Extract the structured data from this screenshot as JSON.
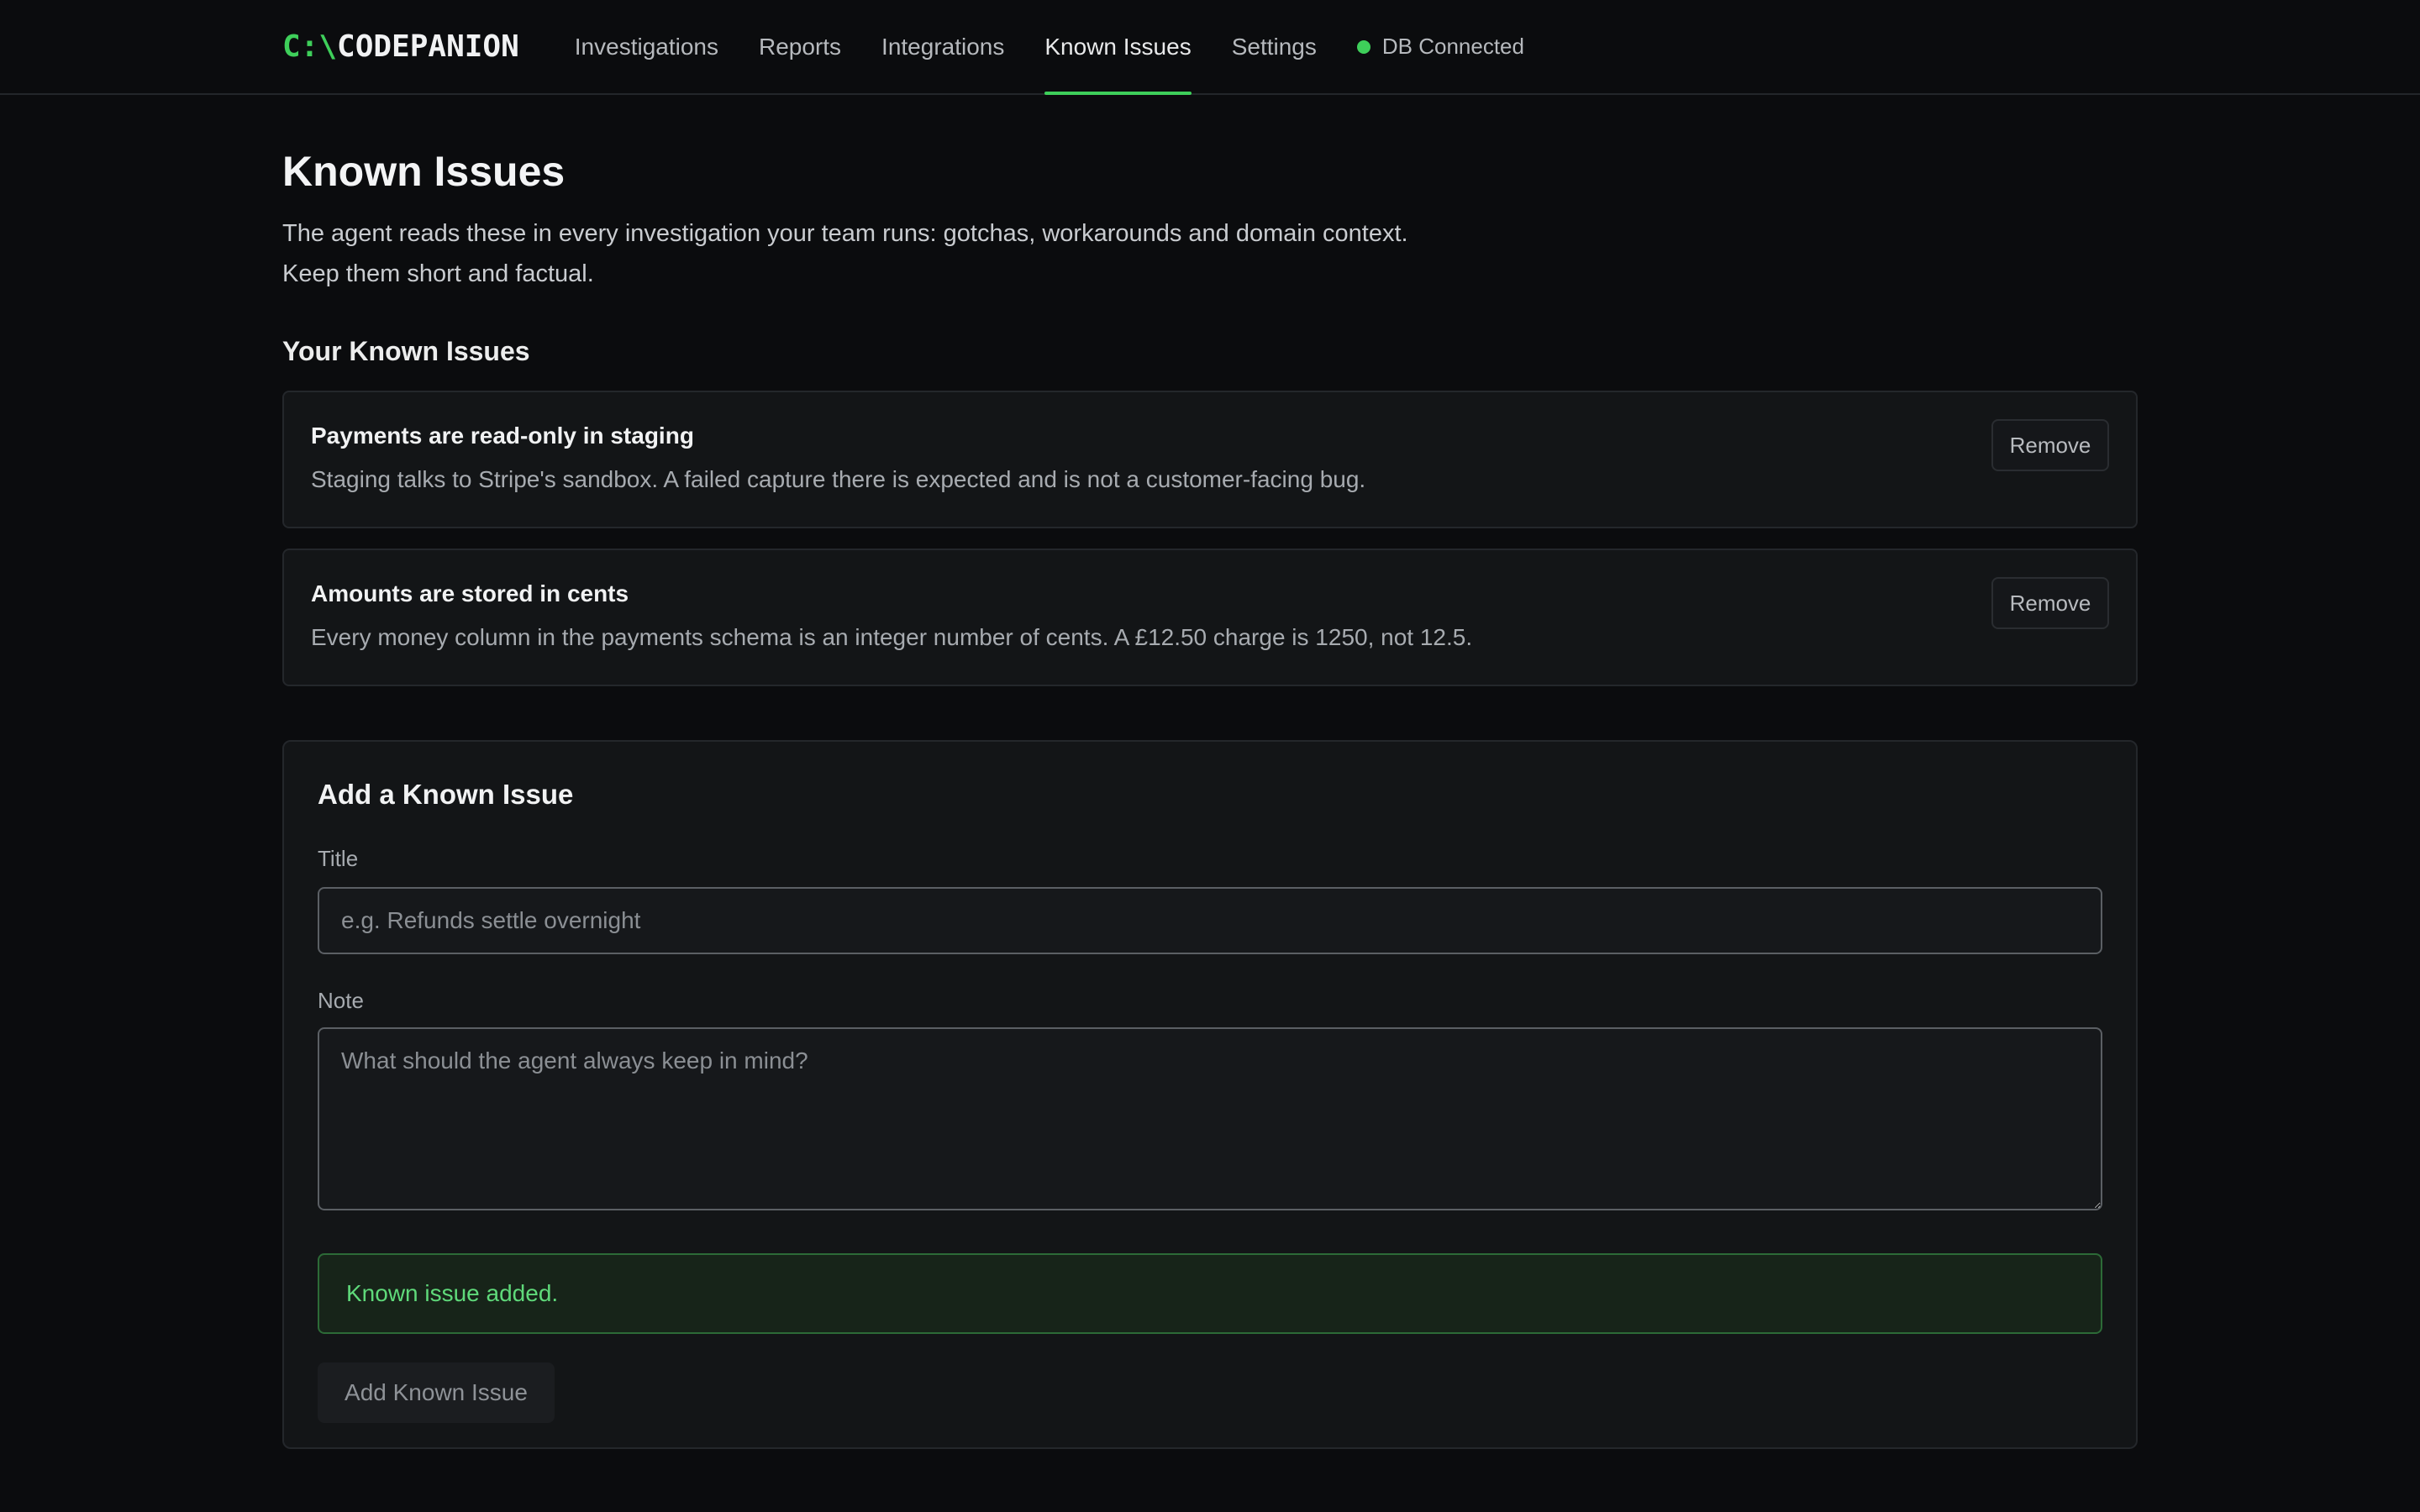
{
  "header": {
    "logo_prefix": "C:\\",
    "logo_name": "CODEPANION",
    "nav": [
      {
        "label": "Investigations"
      },
      {
        "label": "Reports"
      },
      {
        "label": "Integrations"
      },
      {
        "label": "Known Issues"
      },
      {
        "label": "Settings"
      }
    ],
    "active_nav": "Known Issues",
    "status_text": "DB Connected"
  },
  "page": {
    "title": "Known Issues",
    "description": "The agent reads these in every investigation your team runs: gotchas, workarounds and domain context. Keep them short and factual."
  },
  "issues_section": {
    "title": "Your Known Issues",
    "items": [
      {
        "title": "Payments are read-only in staging",
        "note": "Staging talks to Stripe's sandbox. A failed capture there is expected and is not a customer-facing bug.",
        "remove_label": "Remove"
      },
      {
        "title": "Amounts are stored in cents",
        "note": "Every money column in the payments schema is an integer number of cents. A £12.50 charge is 1250, not 12.5.",
        "remove_label": "Remove"
      }
    ]
  },
  "add_form": {
    "title": "Add a Known Issue",
    "title_label": "Title",
    "title_placeholder": "e.g. Refunds settle overnight",
    "title_value": "",
    "note_label": "Note",
    "note_placeholder": "What should the agent always keep in mind?",
    "note_value": "",
    "success_message": "Known issue added.",
    "submit_label": "Add Known Issue"
  },
  "colors": {
    "accent": "#3ecf5a",
    "background": "#0b0c0e",
    "card": "#131517",
    "success_bg": "#172419"
  }
}
